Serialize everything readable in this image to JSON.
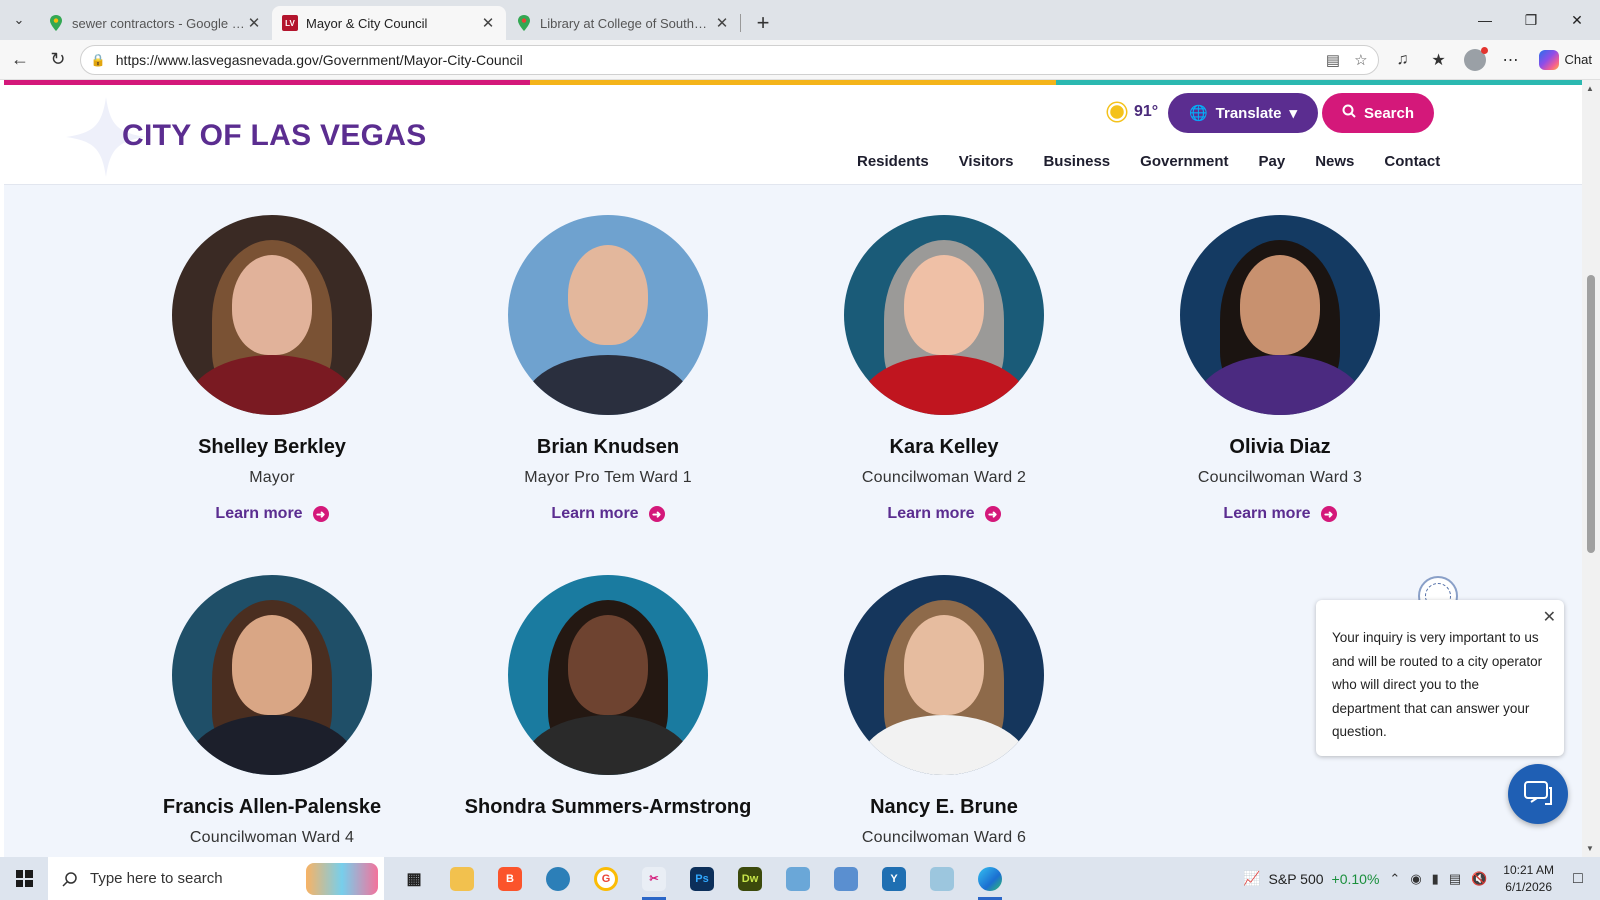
{
  "browser": {
    "tabs": [
      {
        "title": "sewer contractors - Google Maps",
        "favicon": "maps-pin-icon",
        "active": false
      },
      {
        "title": "Mayor & City Council",
        "favicon": "lv-logo-icon",
        "active": true
      },
      {
        "title": "Library at College of Southern Nev",
        "favicon": "maps-pin-icon",
        "active": false
      }
    ],
    "url": "https://www.lasvegasnevada.gov/Government/Mayor-City-Council",
    "chat_label": "Chat",
    "lv_favicon_text": "LV"
  },
  "site": {
    "logo_text": "CITY OF LAS VEGAS",
    "weather": "91°",
    "translate_label": "Translate",
    "search_label": "Search",
    "nav": [
      "Residents",
      "Visitors",
      "Business",
      "Government",
      "Pay",
      "News",
      "Contact"
    ],
    "accent_colors": [
      "#d4187a",
      "#f4b41a",
      "#2bb8b0"
    ],
    "brand_purple": "#5b2d90",
    "brand_pink": "#d4187a"
  },
  "council": {
    "learn_more_label": "Learn more",
    "members": [
      {
        "name": "Shelley Berkley",
        "role": "Mayor"
      },
      {
        "name": "Brian Knudsen",
        "role": "Mayor Pro Tem Ward 1"
      },
      {
        "name": "Kara Kelley",
        "role": "Councilwoman Ward 2"
      },
      {
        "name": "Olivia Diaz",
        "role": "Councilwoman Ward 3"
      },
      {
        "name": "Francis Allen-Palenske",
        "role": "Councilwoman Ward 4"
      },
      {
        "name": "Shondra Summers-Armstrong",
        "role": ""
      },
      {
        "name": "Nancy E. Brune",
        "role": "Councilwoman Ward 6"
      }
    ]
  },
  "chat_popup": {
    "message": "Your inquiry is very important to us and will be routed to a city operator who will direct you to the department that can answer your question."
  },
  "taskbar": {
    "search_placeholder": "Type here to search",
    "stock_label": "S&P 500",
    "stock_change": "+0.10%",
    "time": "10:21 AM",
    "date": "6/1/2026"
  }
}
